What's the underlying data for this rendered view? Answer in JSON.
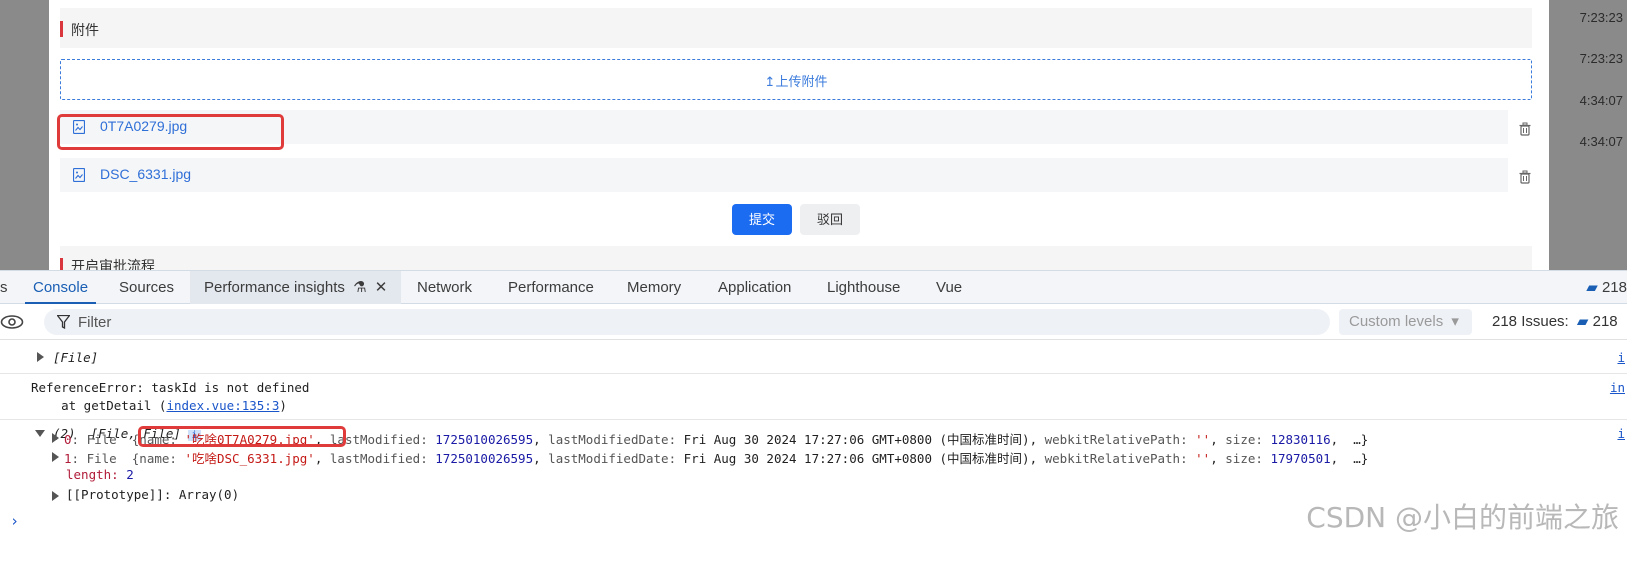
{
  "app": {
    "section_title": "附件",
    "upload_label": "上传附件",
    "files": [
      {
        "name": "0T7A0279.jpg"
      },
      {
        "name": "DSC_6331.jpg"
      }
    ],
    "submit_label": "提交",
    "reject_label": "驳回",
    "next_section_title": "开启审批流程",
    "side_times": [
      "7:23:23",
      "7:23:23",
      "4:34:07",
      "4:34:07"
    ]
  },
  "devtools": {
    "tabs": [
      "s",
      "Console",
      "Sources",
      "Performance insights",
      "Network",
      "Performance",
      "Memory",
      "Application",
      "Lighthouse",
      "Vue"
    ],
    "active_tab": "Console",
    "tab_issue_count": "218",
    "filter_placeholder": "Filter",
    "levels_label": "Custom levels",
    "issues_label": "218 Issues:",
    "issues_count": "218"
  },
  "console": {
    "line1": "[File]",
    "error_line": "ReferenceError: taskId is not defined",
    "error_at": "    at getDetail (",
    "error_link": "index.vue:135:3",
    "error_close": ")",
    "array_header_count": "(2)",
    "array_header_items": "[File, File]",
    "row0": {
      "index": "0",
      "type": "File",
      "name_key": "name:",
      "name_val": "'吃啥0T7A0279.jpg'",
      "lm_key": "lastModified:",
      "lm_val": "1725010026595",
      "lmd_key": "lastModifiedDate:",
      "lmd_val": "Fri Aug 30 2024 17:27:06 GMT+0800 (中国标准时间),",
      "wrp_key": "webkitRelativePath:",
      "wrp_val": "''",
      "size_key": "size:",
      "size_val": "12830116",
      "tail": "…}"
    },
    "row1": {
      "index": "1",
      "type": "File",
      "name_key": "name:",
      "name_val": "'吃啥DSC_6331.jpg'",
      "lm_key": "lastModified:",
      "lm_val": "1725010026595",
      "lmd_key": "lastModifiedDate:",
      "lmd_val": "Fri Aug 30 2024 17:27:06 GMT+0800 (中国标准时间),",
      "wrp_key": "webkitRelativePath:",
      "wrp_val": "''",
      "size_key": "size:",
      "size_val": "17970501",
      "tail": "…}"
    },
    "length_key": "length:",
    "length_val": "2",
    "prototype": "[[Prototype]]: Array(0)",
    "source_links": [
      "i",
      "in",
      "i"
    ]
  },
  "watermark": "CSDN @小白的前端之旅",
  "colors": {
    "accent_blue": "#1c6cf2",
    "highlight_red": "#e03b3b",
    "string_red": "#c41a16",
    "number_blue": "#1a1aa6"
  }
}
